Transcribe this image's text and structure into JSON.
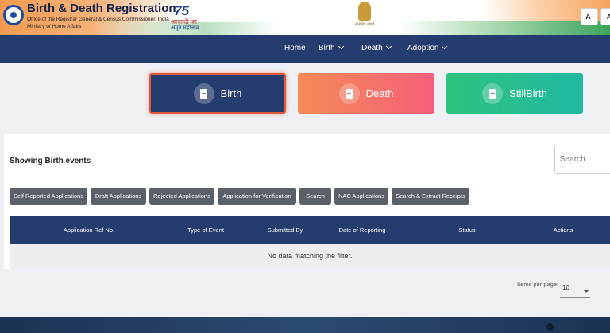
{
  "header": {
    "title": "Birth & Death Registration",
    "subtitle_line1": "Office of the Registrar General & Census Commissioner, India",
    "subtitle_line2": "Ministry of Home Affairs",
    "azadi_number": "75",
    "azadi_line1": "आज़ादी का",
    "azadi_line2": "अमृत महोत्सव",
    "emblem_caption": "सत्यमेव जयते",
    "font_buttons": [
      "A-",
      "A"
    ]
  },
  "nav": {
    "items": [
      {
        "label": "Home",
        "dropdown": false
      },
      {
        "label": "Birth",
        "dropdown": true
      },
      {
        "label": "Death",
        "dropdown": true
      },
      {
        "label": "Adoption",
        "dropdown": true
      }
    ]
  },
  "event_cards": [
    {
      "label": "Birth",
      "color": "#243c6e",
      "active": true
    },
    {
      "label": "Death",
      "color": "#f6607a",
      "active": false
    },
    {
      "label": "StillBirth",
      "color": "#2ec27e",
      "active": false
    }
  ],
  "panel": {
    "title": "Showing Birth events",
    "search_placeholder": "Search"
  },
  "filters": [
    "Self Reported Applications",
    "Draft Applications",
    "Rejected Applications",
    "Application for Verification",
    "Search",
    "NAC Applications",
    "Search & Extract Receipts"
  ],
  "table": {
    "columns": [
      "Application Ref No.",
      "Type of Event",
      "Submitted By",
      "Date of Reporting",
      "Status",
      "Actions"
    ],
    "empty_message": "No data matching the filter."
  },
  "pagination": {
    "items_per_page_label": "Items per page:",
    "items_per_page_value": "10"
  },
  "colors": {
    "nav_bg": "#243c6e",
    "death_card": "#f6607a",
    "stillbirth_card": "#2ec27e"
  }
}
